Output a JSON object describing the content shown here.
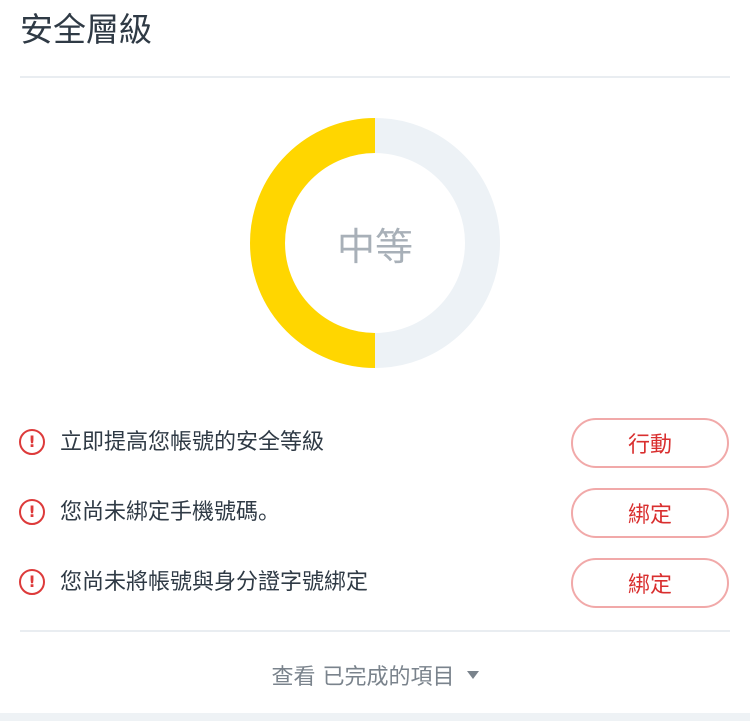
{
  "page": {
    "title": "安全層級"
  },
  "security_level": {
    "label": "中等",
    "progress": 0.5,
    "fill_color": "#FFD600",
    "track_color": "#EDF2F6"
  },
  "tasks": [
    {
      "text": "立即提高您帳號的安全等級",
      "button": "行動",
      "icon": "alert-circle-icon"
    },
    {
      "text": "您尚未綁定手機號碼。",
      "button": "綁定",
      "icon": "alert-circle-icon"
    },
    {
      "text": "您尚未將帳號與身分證字號綁定",
      "button": "綁定",
      "icon": "alert-circle-icon"
    }
  ],
  "alert_icon_glyph": "!",
  "footer": {
    "link_text": "查看 已完成的項目"
  },
  "colors": {
    "alert": "#DD3A3A",
    "button_border": "#F1A9A9",
    "button_text": "#D92F2F"
  }
}
